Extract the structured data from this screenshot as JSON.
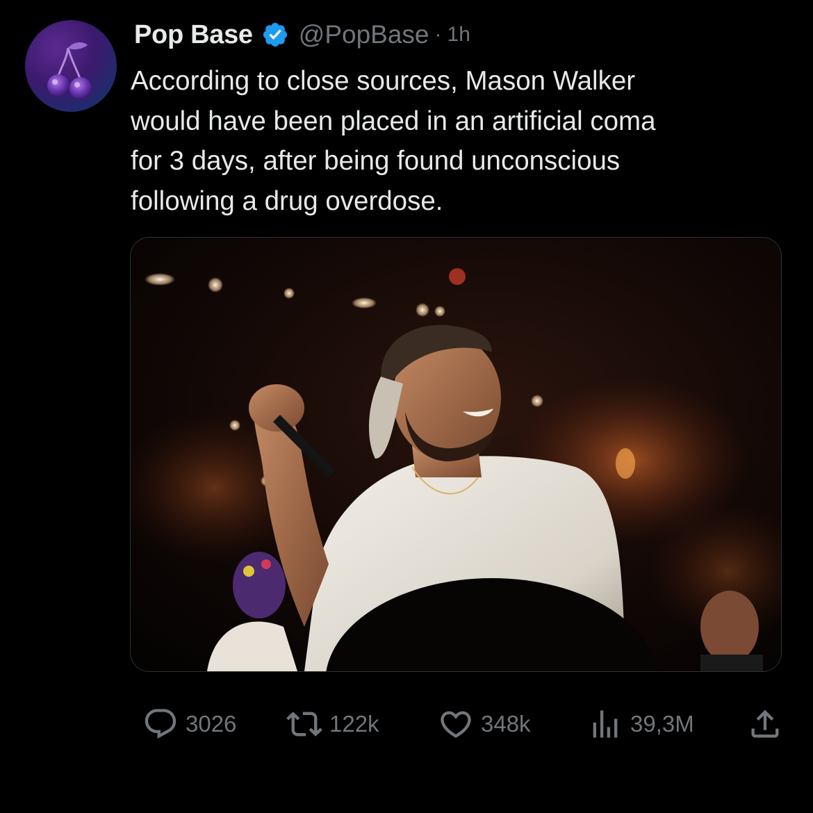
{
  "tweet": {
    "author": {
      "display_name": "Pop Base",
      "handle": "@PopBase",
      "verified": true,
      "avatar_icon": "cherry-icon"
    },
    "separator": "·",
    "time": "1h",
    "text_lines": [
      "According to close sources, Mason Walker",
      "would have been placed in an artificial coma",
      "for 3 days, after being found unconscious",
      "following a drug overdose."
    ],
    "media": {
      "type": "photo",
      "icon": "photo-concert-performer"
    },
    "actions": {
      "reply_count": "3026",
      "repost_count": "122k",
      "like_count": "348k",
      "view_count": "39,3M"
    }
  },
  "colors": {
    "background": "#000000",
    "text_primary": "#e7e9ea",
    "text_secondary": "#71767b",
    "verified_blue": "#1d9bf0"
  }
}
